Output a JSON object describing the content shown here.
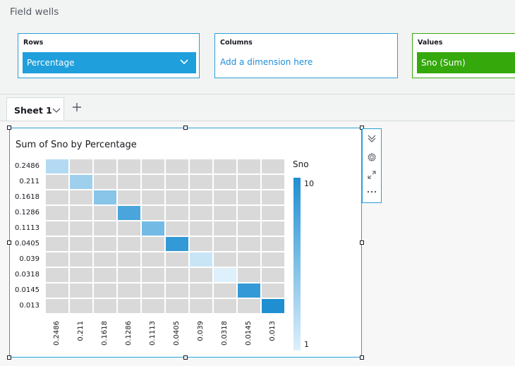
{
  "field_wells": {
    "title": "Field wells",
    "rows": {
      "label": "Rows",
      "field": "Percentage"
    },
    "columns": {
      "label": "Columns",
      "placeholder": "Add a dimension here"
    },
    "values": {
      "label": "Values",
      "field": "Sno (Sum)"
    }
  },
  "sheet_tab": {
    "label": "Sheet 1"
  },
  "visual": {
    "title": "Sum of Sno by Percentage",
    "legend_title": "Sno",
    "legend_max": "10",
    "legend_min": "1"
  },
  "chart_data": {
    "type": "heatmap",
    "title": "Sum of Sno by Percentage",
    "rows": [
      "0.2486",
      "0.211",
      "0.1618",
      "0.1286",
      "0.1113",
      "0.0405",
      "0.039",
      "0.0318",
      "0.0145",
      "0.013"
    ],
    "columns": [
      "0.2486",
      "0.211",
      "0.1618",
      "0.1286",
      "0.1113",
      "0.0405",
      "0.039",
      "0.0318",
      "0.0145",
      "0.013"
    ],
    "cells": [
      {
        "row": "0.2486",
        "col": "0.2486",
        "value": 3
      },
      {
        "row": "0.211",
        "col": "0.211",
        "value": 4
      },
      {
        "row": "0.1618",
        "col": "0.1618",
        "value": 5
      },
      {
        "row": "0.1286",
        "col": "0.1286",
        "value": 8
      },
      {
        "row": "0.1113",
        "col": "0.1113",
        "value": 6
      },
      {
        "row": "0.0405",
        "col": "0.0405",
        "value": 9
      },
      {
        "row": "0.039",
        "col": "0.039",
        "value": 2
      },
      {
        "row": "0.0318",
        "col": "0.0318",
        "value": 1
      },
      {
        "row": "0.0145",
        "col": "0.0145",
        "value": 9
      },
      {
        "row": "0.013",
        "col": "0.013",
        "value": 10
      }
    ],
    "legend": {
      "title": "Sno",
      "min": 1,
      "max": 10,
      "min_color": "#ddf0fb",
      "max_color": "#1f8fd2"
    },
    "empty_color": "#d9d9d9"
  }
}
